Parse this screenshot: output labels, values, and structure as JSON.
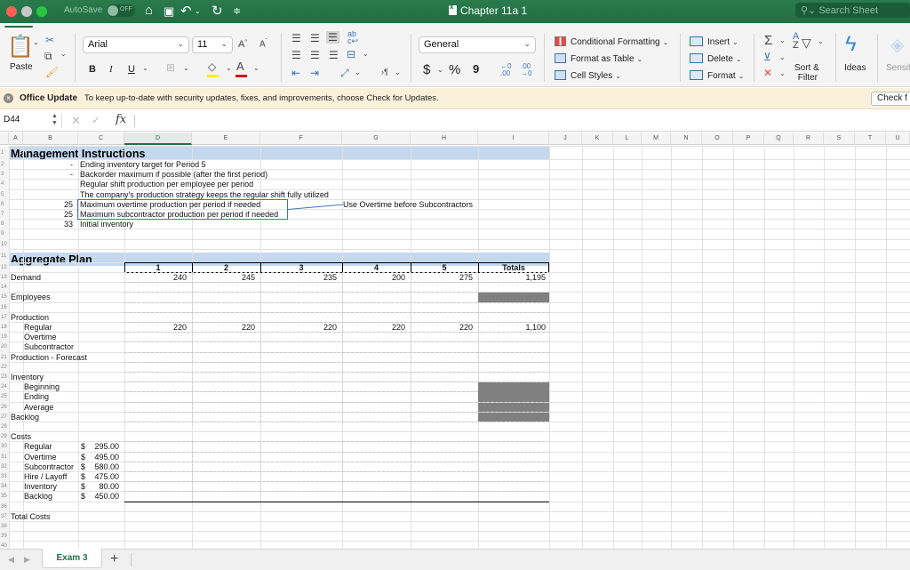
{
  "window": {
    "title": "Chapter 11a 1",
    "autosave_label": "AutoSave",
    "autosave_state": "OFF",
    "search_placeholder": "Search Sheet"
  },
  "ribbon": {
    "paste_label": "Paste",
    "font_name": "Arial",
    "font_size": "11",
    "bold": "B",
    "italic": "I",
    "underline": "U",
    "number_format": "General",
    "currency": "$",
    "percent": "%",
    "comma": "9",
    "conditional_formatting": "Conditional Formatting",
    "format_as_table": "Format as Table",
    "cell_styles": "Cell Styles",
    "insert": "Insert",
    "delete": "Delete",
    "format": "Format",
    "sort_filter_line1": "Sort &",
    "sort_filter_line2": "Filter",
    "ideas": "Ideas",
    "sensitivity": "Sensit",
    "fill_color": "#ffef00",
    "font_color": "#e00000"
  },
  "message_bar": {
    "title": "Office Update",
    "text": "To keep up-to-date with security updates, fixes, and improvements, choose Check for Updates.",
    "button": "Check f"
  },
  "formula_bar": {
    "name_box": "D44",
    "fx": "fx",
    "formula": ""
  },
  "columns": [
    "A",
    "B",
    "C",
    "D",
    "E",
    "F",
    "G",
    "H",
    "I",
    "J",
    "K",
    "L",
    "M",
    "N",
    "O",
    "P",
    "Q",
    "R",
    "S",
    "T",
    "U"
  ],
  "selected_column": "D",
  "rows": [
    "1",
    "2",
    "3",
    "4",
    "5",
    "6",
    "7",
    "8",
    "9",
    "10",
    "11",
    "12",
    "13",
    "14",
    "15",
    "16",
    "17",
    "18",
    "19",
    "20",
    "21",
    "22",
    "23",
    "24",
    "25",
    "26",
    "27",
    "28",
    "29",
    "30",
    "31",
    "32",
    "33",
    "34",
    "35",
    "36",
    "37",
    "38",
    "39",
    "40"
  ],
  "management": {
    "title": "Management Instructions",
    "items": [
      {
        "value": "-",
        "text": "Ending inventory target for Period 5"
      },
      {
        "value": "-",
        "text": "Backorder maximum if possible (after the first period)"
      },
      {
        "value": "",
        "text": "Regular shift production per employee per period"
      },
      {
        "value": "",
        "text": "The company's production strategy keeps the regular shift fully utilized"
      },
      {
        "value": "25",
        "text": "Maximum overtime production per period if needed"
      },
      {
        "value": "25",
        "text": "Maximum subcontractor production per period if needed"
      },
      {
        "value": "33",
        "text": "Initial inventory"
      }
    ],
    "note": "Use Overtime before Subcontractors"
  },
  "plan": {
    "title": "Aggregate Plan",
    "periods": [
      "1",
      "2",
      "3",
      "4",
      "5"
    ],
    "totals_label": "Totals",
    "labels": {
      "demand": "Demand",
      "employees": "Employees",
      "production": "Production",
      "regular": "Regular",
      "overtime": "Overtime",
      "subcontractor": "Subcontractor",
      "prod_forecast": "Production - Forecast",
      "inventory": "Inventory",
      "beginning": "Beginning",
      "ending": "Ending",
      "average": "Average",
      "backlog": "Backlog",
      "costs": "Costs",
      "total_costs": "Total Costs"
    },
    "demand": [
      "240",
      "245",
      "235",
      "200",
      "275"
    ],
    "demand_total": "1,195",
    "regular": [
      "220",
      "220",
      "220",
      "220",
      "220"
    ],
    "regular_total": "1,100",
    "costs": [
      {
        "label": "Regular",
        "cur": "$",
        "amount": "295.00"
      },
      {
        "label": "Overtime",
        "cur": "$",
        "amount": "495.00"
      },
      {
        "label": "Subcontractor",
        "cur": "$",
        "amount": "580.00"
      },
      {
        "label": "Hire / Layoff",
        "cur": "$",
        "amount": "475.00"
      },
      {
        "label": "Inventory",
        "cur": "$",
        "amount": "80.00"
      },
      {
        "label": "Backlog",
        "cur": "$",
        "amount": "450.00"
      }
    ]
  },
  "sheets": {
    "active": "Exam 3",
    "add": "+"
  }
}
